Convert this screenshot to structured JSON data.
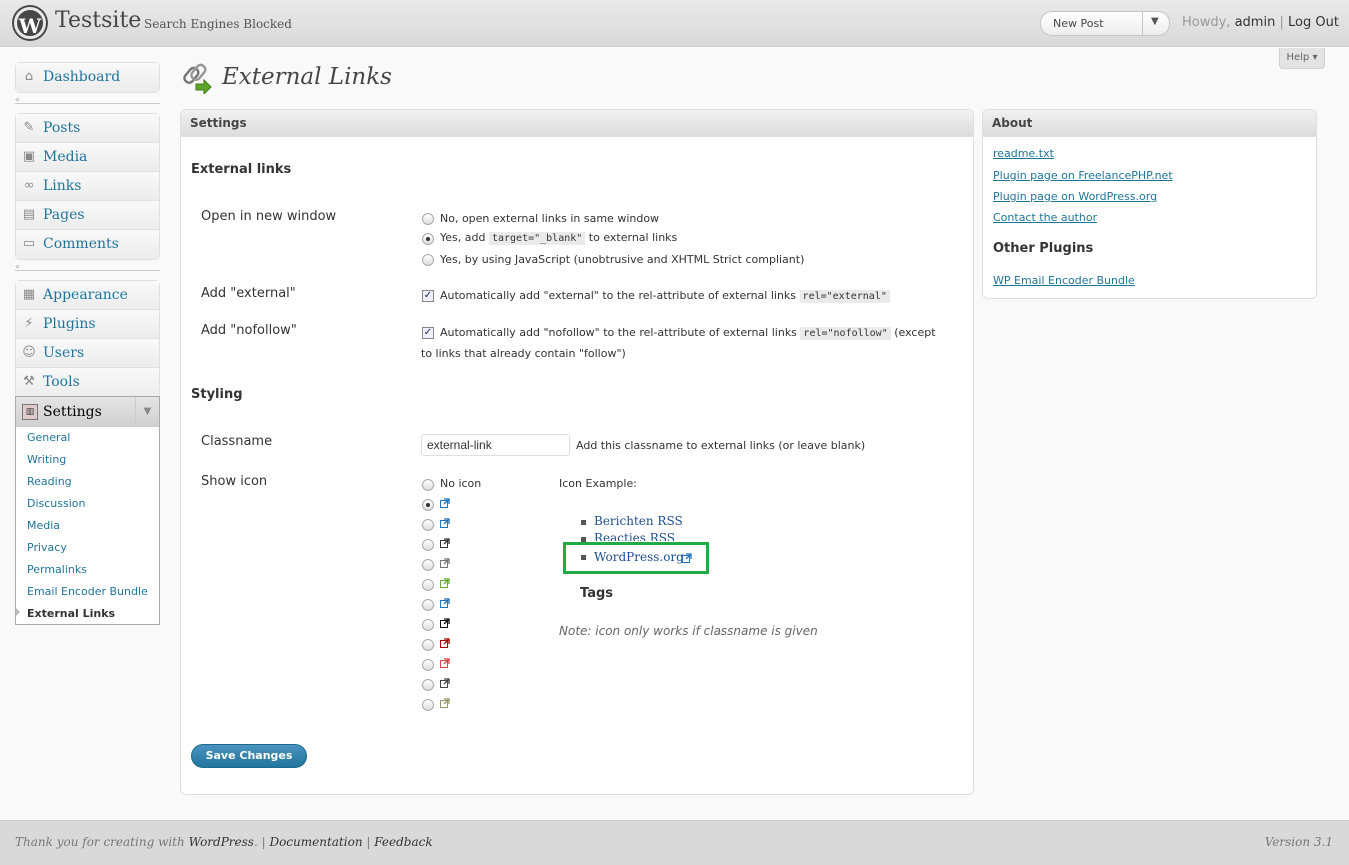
{
  "header": {
    "site_title": "Testsite",
    "visibility": "Search Engines Blocked",
    "favorite": {
      "selected": "New Post"
    },
    "howdy": "Howdy,",
    "username": "admin",
    "separator": "|",
    "logout": "Log Out",
    "help": "Help"
  },
  "menu": {
    "dashboard": "Dashboard",
    "group1": [
      "Posts",
      "Media",
      "Links",
      "Pages",
      "Comments"
    ],
    "group2": [
      "Appearance",
      "Plugins",
      "Users",
      "Tools"
    ],
    "settings": "Settings",
    "settings_sub": [
      "General",
      "Writing",
      "Reading",
      "Discussion",
      "Media",
      "Privacy",
      "Permalinks",
      "Email Encoder Bundle",
      "External Links"
    ]
  },
  "page": {
    "title": "External Links",
    "settings_box_title": "Settings",
    "section_external": "External links",
    "open_new_window_label": "Open in new window",
    "opt_no": "No, open external links in same window",
    "opt_yes_prefix": "Yes, add",
    "opt_yes_code": "target=\"_blank\"",
    "opt_yes_suffix": "to external links",
    "opt_js": "Yes, by using JavaScript (unobtrusive and XHTML Strict compliant)",
    "add_external_label": "Add \"external\"",
    "add_external_text": "Automatically add \"external\" to the rel-attribute of external links",
    "add_external_code": "rel=\"external\"",
    "add_nofollow_label": "Add \"nofollow\"",
    "add_nofollow_text": "Automatically add \"nofollow\" to the rel-attribute of external links",
    "add_nofollow_code": "rel=\"nofollow\"",
    "add_nofollow_tail1": "(except",
    "add_nofollow_tail2": "to links that already contain \"follow\")",
    "section_styling": "Styling",
    "classname_label": "Classname",
    "classname_value": "external-link",
    "classname_help": "Add this classname to external links (or leave blank)",
    "show_icon_label": "Show icon",
    "no_icon": "No icon",
    "icon_example_label": "Icon Example:",
    "example_items": [
      "Berichten RSS",
      "Reacties RSS",
      "WordPress.org"
    ],
    "tags_heading": "Tags",
    "note": "Note: icon only works if classname is given",
    "save": "Save Changes"
  },
  "about": {
    "title": "About",
    "links": [
      "readme.txt",
      "Plugin page on FreelancePHP.net",
      "Plugin page on WordPress.org",
      "Contact the author"
    ],
    "other_title": "Other Plugins",
    "other_links": [
      "WP Email Encoder Bundle"
    ]
  },
  "footer": {
    "thanks_prefix": "Thank you for creating with",
    "wordpress": "WordPress",
    "documentation": "Documentation",
    "feedback": "Feedback",
    "version": "Version 3.1"
  },
  "colors": {
    "accent": "#21759b",
    "highlight": "#22aa44",
    "icon_colors": [
      "#1e73be",
      "#1e73be",
      "#333",
      "#777",
      "#6a3",
      "#1e73be",
      "#111",
      "#a00",
      "#d44",
      "#444",
      "#996"
    ]
  },
  "icon_option_selected_index": 1
}
